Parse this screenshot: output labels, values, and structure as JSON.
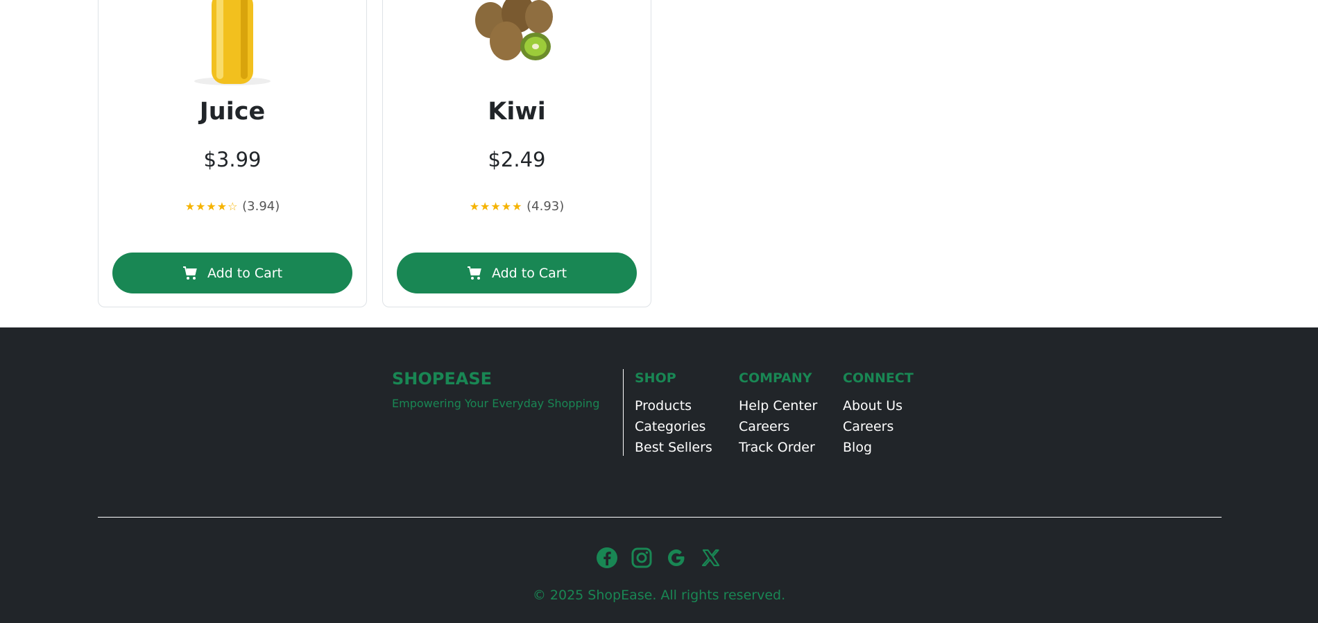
{
  "products": [
    {
      "name": "Juice",
      "price": "$3.99",
      "stars": "★★★★☆",
      "rating": "(3.94)",
      "cta": "Add to Cart"
    },
    {
      "name": "Kiwi",
      "price": "$2.49",
      "stars": "★★★★★",
      "rating": "(4.93)",
      "cta": "Add to Cart"
    }
  ],
  "footer": {
    "brand": "SHOPEASE",
    "tagline": "Empowering Your Everyday Shopping",
    "shop": {
      "title": "SHOP",
      "links": [
        "Products",
        "Categories",
        "Best Sellers"
      ]
    },
    "company": {
      "title": "COMPANY",
      "links": [
        "Help Center",
        "Careers",
        "Track Order"
      ]
    },
    "connect": {
      "title": "CONNECT",
      "links": [
        "About Us",
        "Careers",
        "Blog"
      ]
    },
    "social_icons": [
      "facebook-icon",
      "instagram-icon",
      "google-icon",
      "x-icon"
    ],
    "copyright": "© 2025 ShopEase. All rights reserved."
  },
  "colors": {
    "accent": "#198754",
    "footer_bg": "#212529",
    "star": "#f5b301"
  }
}
